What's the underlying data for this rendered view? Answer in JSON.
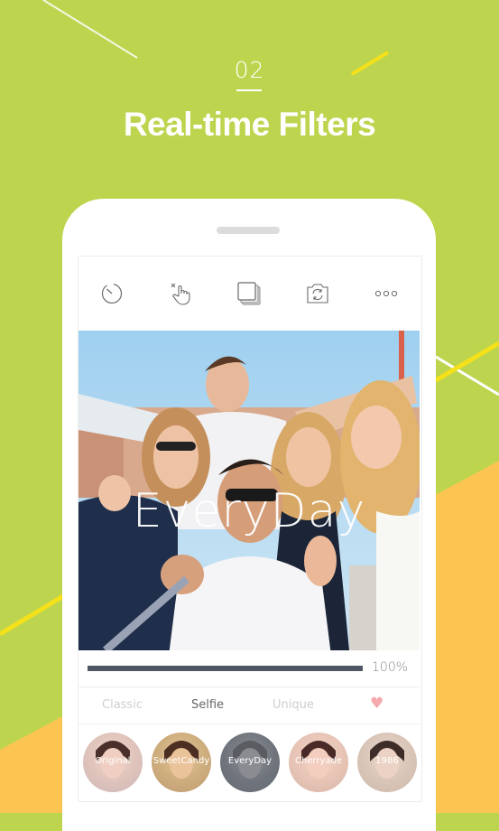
{
  "header": {
    "step_number": "02",
    "title": "Real-time Filters"
  },
  "colors": {
    "background_green": "#bdd54e",
    "background_orange": "#fcc552",
    "accent_yellow": "#f5e11a",
    "progress_bar": "#4e5663",
    "heart_pink": "#f4a9ad",
    "tab_active": "#666666",
    "tab_inactive": "#cfcfcf"
  },
  "toolbar": {
    "buttons": [
      {
        "icon": "timer-icon",
        "label": "Timer"
      },
      {
        "icon": "touch-shot-off-icon",
        "label": "Touch shot"
      },
      {
        "icon": "collage-icon",
        "label": "Collage"
      },
      {
        "icon": "switch-camera-icon",
        "label": "Switch camera"
      },
      {
        "icon": "more-icon",
        "label": "More"
      }
    ]
  },
  "preview": {
    "filter_name_overlay": "EveryDay"
  },
  "intensity": {
    "value_percent": 100,
    "label": "100%"
  },
  "filter_tabs": [
    {
      "label": "Classic",
      "active": false
    },
    {
      "label": "Selfie",
      "active": true
    },
    {
      "label": "Unique",
      "active": false
    },
    {
      "label": "♥",
      "icon": "heart-icon",
      "active": false
    }
  ],
  "filters": [
    {
      "label": "Original",
      "selected": false
    },
    {
      "label": "SweetCandy",
      "selected": false
    },
    {
      "label": "EveryDay",
      "selected": true
    },
    {
      "label": "Cherryade",
      "selected": false
    },
    {
      "label": "1986",
      "selected": false
    }
  ]
}
